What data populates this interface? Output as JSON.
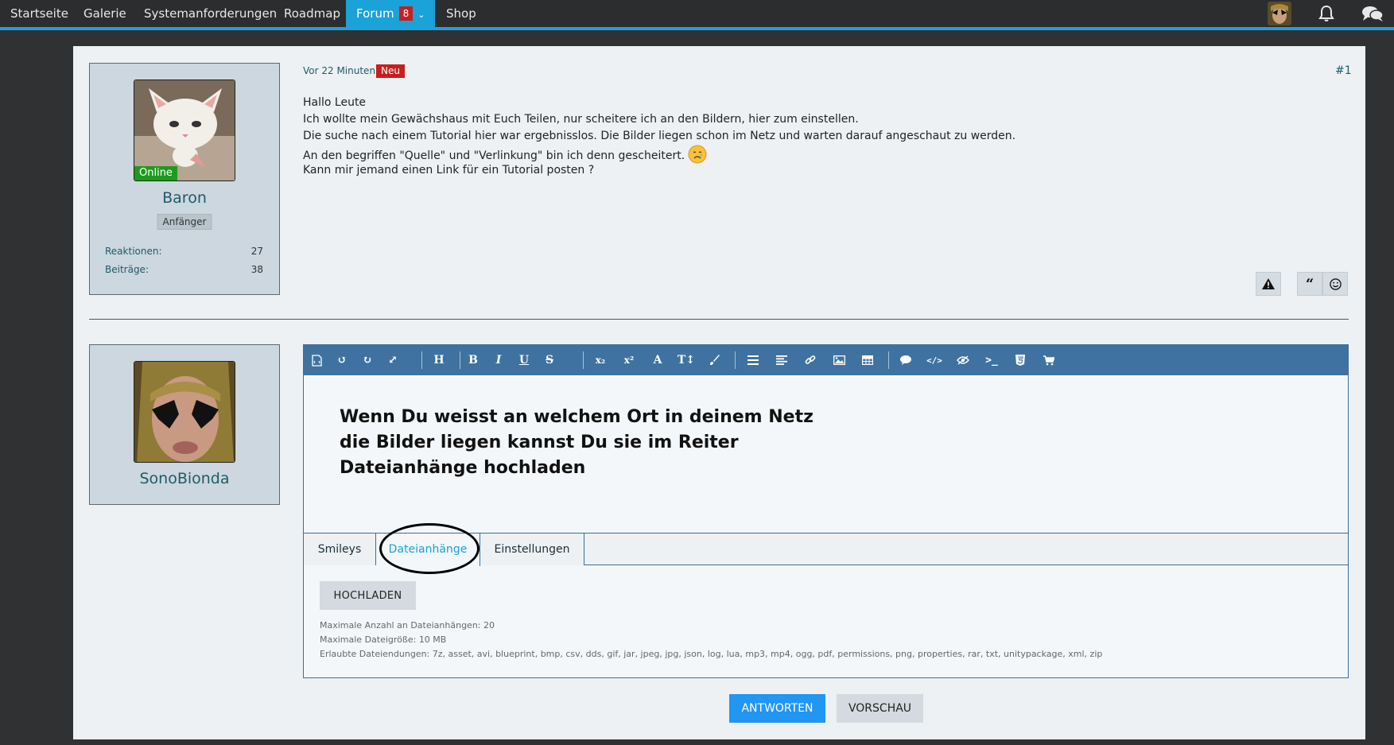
{
  "nav": {
    "items": [
      {
        "label": "Startseite"
      },
      {
        "label": "Galerie"
      },
      {
        "label": "Systemanforderungen"
      },
      {
        "label": "Roadmap"
      },
      {
        "label": "Forum",
        "badge": "8"
      },
      {
        "label": "Shop"
      }
    ],
    "icons": [
      "avatar",
      "bell-icon",
      "chat-bubbles-icon"
    ]
  },
  "post": {
    "author": {
      "name": "Baron",
      "status": "Online",
      "rank": "Anfänger",
      "stats": [
        {
          "label": "Reaktionen:",
          "value": "27"
        },
        {
          "label": "Beiträge:",
          "value": "38"
        }
      ]
    },
    "time": "Vor 22 Minuten",
    "new_badge": "Neu",
    "number": "#1",
    "lines": [
      "Hallo Leute",
      "Ich wollte mein Gewächshaus mit Euch Teilen, nur scheitere ich an den Bildern, hier zum einstellen.",
      "Die suche nach einem Tutorial hier war ergebnisslos. Die Bilder liegen schon im Netz und warten darauf angeschaut zu werden.",
      "An den begriffen \"Quelle\" und \"Verlinkung\" bin ich denn gescheitert.",
      "Kann mir jemand einen Link für ein Tutorial posten ?"
    ]
  },
  "reply": {
    "author": {
      "name": "SonoBionda"
    },
    "editor_text": "Wenn Du weisst an welchem Ort in deinem Netz die Bilder liegen kannst Du sie im Reiter Dateianhänge hochladen",
    "tabs": [
      {
        "label": "Smileys"
      },
      {
        "label": "Dateianhänge",
        "active": true
      },
      {
        "label": "Einstellungen"
      }
    ],
    "upload_label": "HOCHLADEN",
    "info": [
      "Maximale Anzahl an Dateianhängen: 20",
      "Maximale Dateigröße: 10 MB",
      "Erlaubte Dateiendungen: 7z, asset, avi, blueprint, bmp, csv, dds, gif, jar, jpeg, jpg, json, log, lua, mp3, mp4, ogg, pdf, permissions, png, properties, rar, txt, unitypackage, xml, zip"
    ],
    "submit_label": "ANTWORTEN",
    "preview_label": "VORSCHAU"
  },
  "toolbar_tools": [
    "source-icon",
    "undo-icon",
    "redo-icon",
    "fullscreen-icon",
    "heading-icon",
    "bold-icon",
    "italic-icon",
    "underline-icon",
    "strikethrough-icon",
    "subscript-icon",
    "superscript-icon",
    "font-icon",
    "font-size-icon",
    "paint-brush-icon",
    "list-icon",
    "align-icon",
    "link-icon",
    "image-icon",
    "table-icon",
    "quote-bubble-icon",
    "code-icon",
    "spoiler-icon",
    "terminal-icon",
    "html5-icon",
    "cart-icon"
  ],
  "colors": {
    "accent": "#1ba2d8",
    "toolbar": "#3f72a0",
    "primary_button": "#2196f3",
    "badge": "#c81e1e",
    "online": "#1b9c1b"
  }
}
